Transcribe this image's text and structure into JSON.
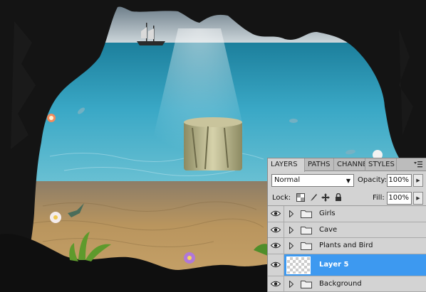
{
  "panel": {
    "tabs": [
      "LAYERS",
      "PATHS",
      "CHANNE",
      "STYLES"
    ],
    "active_tab": "LAYERS",
    "blend_mode": "Normal",
    "opacity_label": "Opacity:",
    "opacity_value": "100%",
    "lock_label": "Lock:",
    "fill_label": "Fill:",
    "fill_value": "100%",
    "layers": [
      {
        "name": "Girls",
        "type": "group",
        "visible": true
      },
      {
        "name": "Cave",
        "type": "group",
        "visible": true
      },
      {
        "name": "Plants and Bird",
        "type": "group",
        "visible": true
      },
      {
        "name": "Layer 5",
        "type": "layer",
        "visible": true,
        "selected": true
      },
      {
        "name": "Background",
        "type": "group",
        "visible": true
      }
    ]
  },
  "colors": {
    "selection": "#3d99f0",
    "panel_bg": "#d3d3d3",
    "water": "#3aa8c6",
    "sand": "#b9955e",
    "rock": "#141414"
  },
  "icons": [
    "eye-icon",
    "expand-triangle-icon",
    "folder-icon",
    "panel-menu-icon",
    "lock-transparent-icon",
    "lock-paint-icon",
    "lock-move-icon",
    "lock-all-icon",
    "dropdown-caret-icon",
    "flyout-arrow-icon"
  ]
}
